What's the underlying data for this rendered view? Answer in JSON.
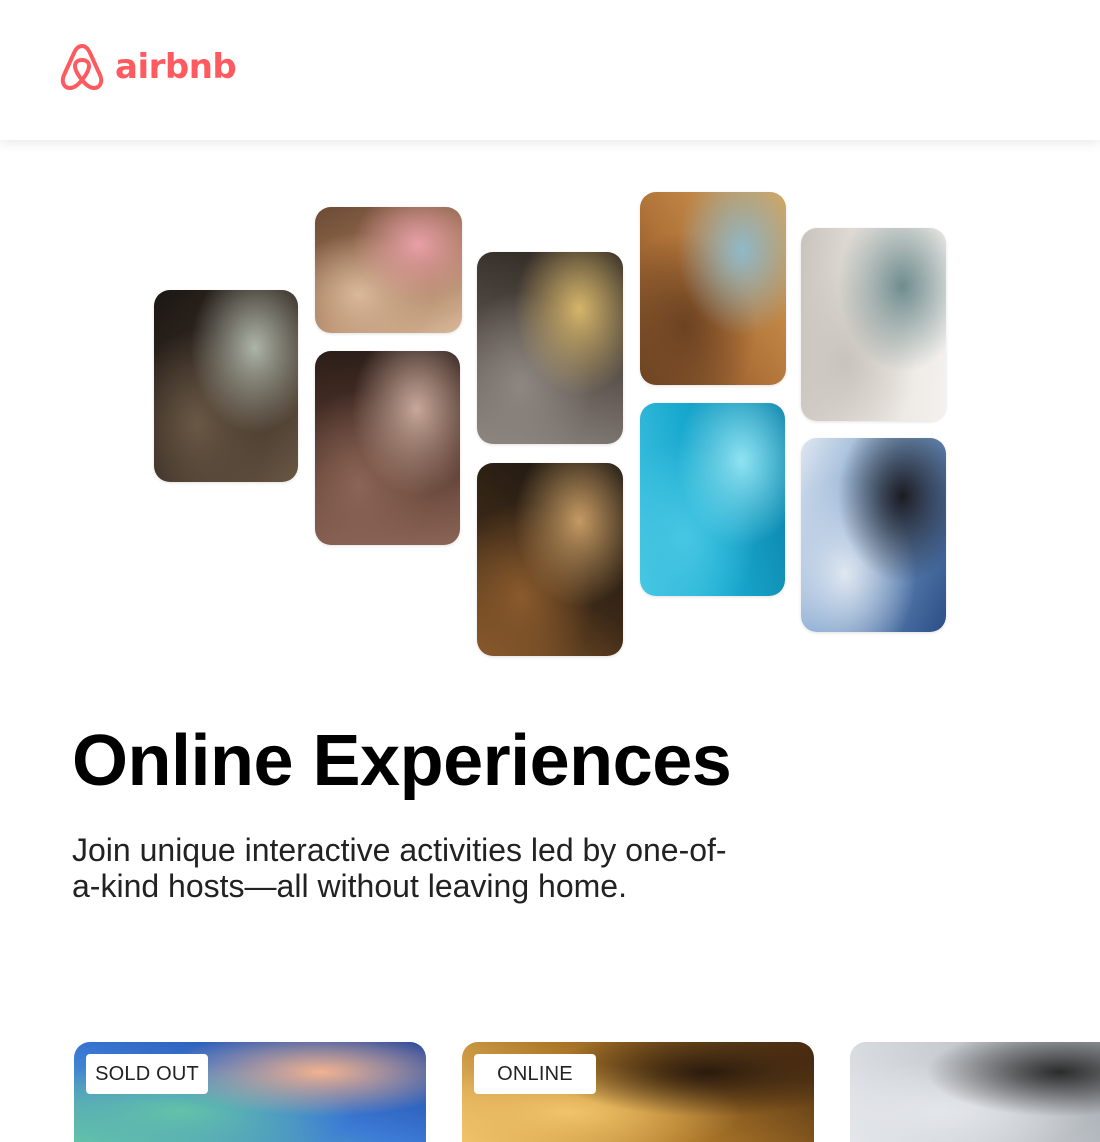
{
  "brand": {
    "name": "airbnb",
    "color": "#ff5a5f",
    "logo_icon": "belo-icon"
  },
  "collage": [
    {
      "subject": "cooking-pans",
      "palette": [
        "#1c1714",
        "#3a2e25",
        "#6a5845",
        "#aeb4a8"
      ]
    },
    {
      "subject": "baker-woman",
      "palette": [
        "#6b4a34",
        "#a4785a",
        "#d9b99a",
        "#e8a0a8"
      ]
    },
    {
      "subject": "dancer-doorway",
      "palette": [
        "#2b1d18",
        "#5a3c31",
        "#8b6556",
        "#c7a89a"
      ]
    },
    {
      "subject": "food-bowl",
      "palette": [
        "#2a2420",
        "#5b534c",
        "#8e8781",
        "#d6b56a"
      ]
    },
    {
      "subject": "guitar",
      "palette": [
        "#15130f",
        "#3a2817",
        "#8a5a2c",
        "#c59a63"
      ]
    },
    {
      "subject": "keyboard-microphone",
      "palette": [
        "#d9a65a",
        "#b07238",
        "#6b4222",
        "#8fb9c9"
      ]
    },
    {
      "subject": "swimmer",
      "palette": [
        "#0a7fa6",
        "#19a9cf",
        "#47c7e3",
        "#8fe3f2"
      ]
    },
    {
      "subject": "yoga",
      "palette": [
        "#f4f1ee",
        "#e7e2dc",
        "#c9c3bd",
        "#6f8c8e"
      ]
    },
    {
      "subject": "singer",
      "palette": [
        "#2b4e86",
        "#7aa0cc",
        "#dfe7f1",
        "#1c1c22"
      ]
    }
  ],
  "hero": {
    "title": "Online Experiences",
    "subtitle": "Join unique interactive activities led by one-of-a-kind hosts—all without leaving home."
  },
  "cards": [
    {
      "badge": "SOLD OUT",
      "palette": [
        "#1b3f9a",
        "#3c7bd6",
        "#63c2a8",
        "#f2b38f"
      ]
    },
    {
      "badge": "ONLINE",
      "palette": [
        "#4a2b10",
        "#b07a2a",
        "#f1c46a",
        "#2a1a0d"
      ]
    },
    {
      "badge": "",
      "palette": [
        "#9aa0a6",
        "#c7cbd0",
        "#e3e6ea",
        "#2b2b2b"
      ]
    }
  ]
}
